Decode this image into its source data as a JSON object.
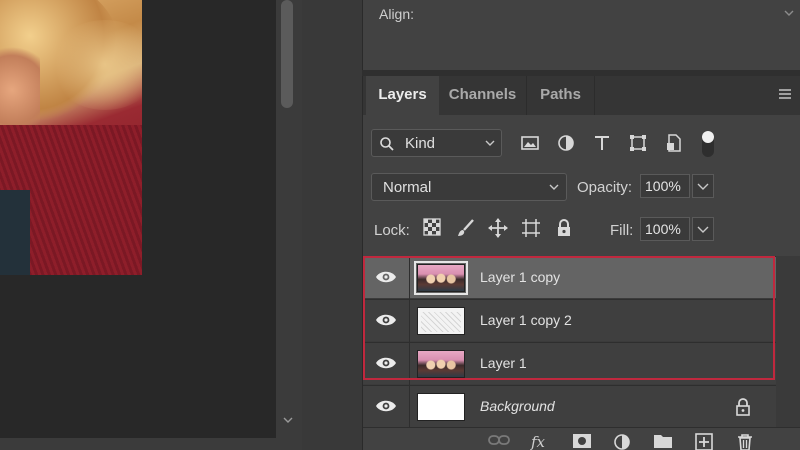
{
  "properties": {
    "align_label": "Align:"
  },
  "tabs": [
    {
      "label": "Layers",
      "active": true
    },
    {
      "label": "Channels",
      "active": false
    },
    {
      "label": "Paths",
      "active": false
    }
  ],
  "filter": {
    "kind_label": "Kind",
    "icons": [
      "image-filter-icon",
      "adjustment-filter-icon",
      "type-filter-icon",
      "shape-filter-icon",
      "smart-object-filter-icon"
    ]
  },
  "blend": {
    "mode": "Normal",
    "opacity_label": "Opacity:",
    "opacity_value": "100%"
  },
  "lock": {
    "label": "Lock:",
    "icons": [
      "lock-transparent-icon",
      "lock-image-icon",
      "lock-position-icon",
      "lock-artboard-icon",
      "lock-all-icon"
    ],
    "fill_label": "Fill:",
    "fill_value": "100%"
  },
  "layers": [
    {
      "name": "Layer 1 copy",
      "thumbnail": "photo",
      "selected": true,
      "visible": true
    },
    {
      "name": "Layer 1 copy 2",
      "thumbnail": "sketch",
      "selected": false,
      "visible": true
    },
    {
      "name": "Layer 1",
      "thumbnail": "photo",
      "selected": false,
      "visible": true
    },
    {
      "name": "Background",
      "thumbnail": "white",
      "selected": false,
      "visible": true,
      "locked": true
    }
  ],
  "footer_icons": [
    "link-layers-icon",
    "fx-icon",
    "add-mask-icon",
    "new-adjustment-icon",
    "new-group-icon",
    "new-layer-icon",
    "delete-icon"
  ],
  "colors": {
    "highlight": "#c0283e",
    "panel_bg": "#424242",
    "selected_row": "#646464"
  }
}
